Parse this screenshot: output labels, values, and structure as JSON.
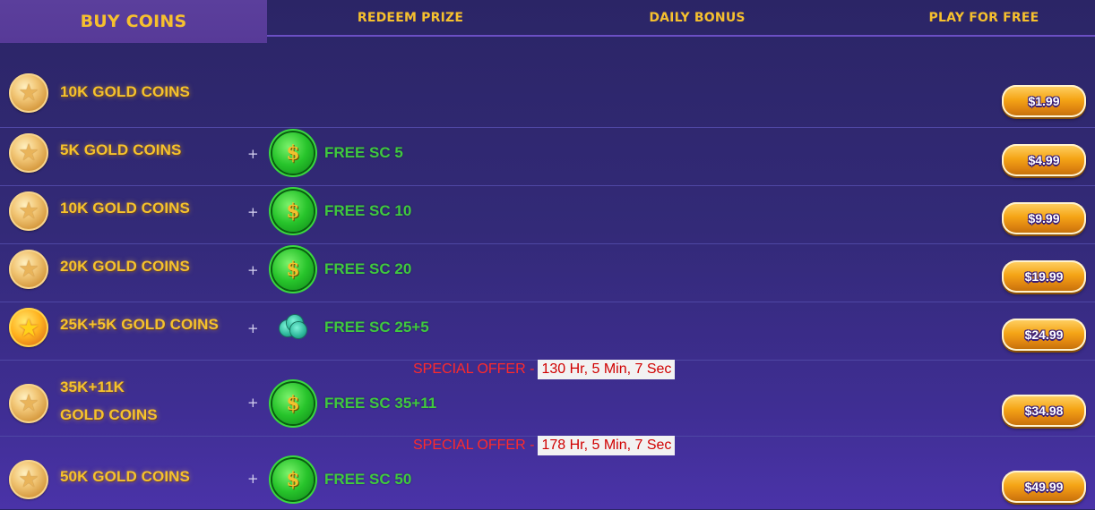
{
  "tabs": [
    {
      "label": "BUY COINS",
      "active": true
    },
    {
      "label": "REDEEM PRIZE",
      "active": false
    },
    {
      "label": "DAILY BONUS",
      "active": false
    },
    {
      "label": "PLAY FOR FREE",
      "active": false
    }
  ],
  "plus_sign": "+",
  "packages": [
    {
      "gc_label": "10K GOLD COINS",
      "sc_label": "",
      "price": "$1.99",
      "coin_icon": "gold-coin-icon"
    },
    {
      "gc_label": "5K GOLD COINS",
      "sc_label": "FREE SC 5",
      "price": "$4.99",
      "coin_icon": "gold-coin-icon",
      "sc_icon": "sweeps-coin-dollar-icon"
    },
    {
      "gc_label": "10K GOLD COINS",
      "sc_label": "FREE SC 10",
      "price": "$9.99",
      "coin_icon": "gold-coin-icon",
      "sc_icon": "sweeps-coin-dollar-icon"
    },
    {
      "gc_label": "20K GOLD COINS",
      "sc_label": "FREE SC 20",
      "price": "$19.99",
      "coin_icon": "gold-coin-icon",
      "sc_icon": "sweeps-coin-dollar-icon"
    },
    {
      "gc_label": "25K+5K GOLD COINS",
      "sc_label": "FREE SC 25+5",
      "price": "$24.99",
      "coin_icon": "gold-star-coin-icon",
      "sc_icon": "sweeps-coin-stack-icon"
    },
    {
      "gc_label_line1": "35K+11K",
      "gc_label_line2": "GOLD COINS",
      "sc_label": "FREE SC 35+11",
      "price": "$34.98",
      "coin_icon": "gold-coin-icon",
      "sc_icon": "sweeps-coin-dollar-icon",
      "offer_label": "SPECIAL OFFER - ",
      "offer_timer": "130 Hr, 5 Min, 7 Sec"
    },
    {
      "gc_label": "50K GOLD COINS",
      "sc_label": "FREE SC 50",
      "price": "$49.99",
      "coin_icon": "gold-coin-icon",
      "sc_icon": "sweeps-coin-dollar-icon",
      "offer_label": "SPECIAL OFFER - ",
      "offer_timer": "178 Hr, 5 Min, 7 Sec"
    }
  ],
  "colors": {
    "tab_text": "#f6c02e",
    "gold_text": "#f6c22c",
    "sc_text": "#3fc93f",
    "offer_text": "#ff2a2a",
    "background": "#332a78"
  }
}
